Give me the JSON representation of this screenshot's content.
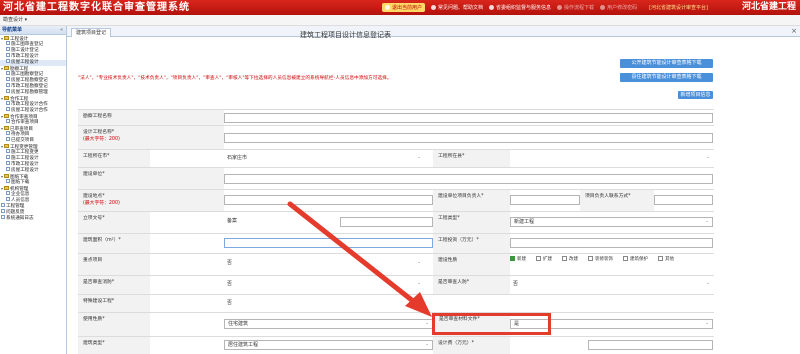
{
  "header": {
    "title_left": "河北省建工程数字化联合审查管理系统",
    "title_right": "河北省建工程",
    "nav": [
      {
        "label": "退出当前用户",
        "active": true
      },
      {
        "label": "常见问题、帮助文档",
        "active": false
      },
      {
        "label": "省委组织监督与服务信息",
        "active": false
      },
      {
        "label": "操作流程下载",
        "active": false,
        "disabled": true
      },
      {
        "label": "用户修改密码",
        "active": false,
        "disabled": true
      }
    ],
    "bracket_title": "[河北省建筑设计审查平台]"
  },
  "user_menu": "勘查设计 ▾",
  "sidebar": {
    "header": "导航菜单",
    "close": "«",
    "items": [
      {
        "label": "工程设计",
        "level": 0,
        "type": "folder",
        "toggle": "▾"
      },
      {
        "label": "施工图审查登记",
        "level": 1,
        "type": "file"
      },
      {
        "label": "施工设计登记",
        "level": 1,
        "type": "file"
      },
      {
        "label": "市政工程设计",
        "level": 1,
        "type": "file"
      },
      {
        "label": "房屋工程设计",
        "level": 1,
        "type": "file",
        "selected": true
      },
      {
        "label": "勘察工程",
        "level": 0,
        "type": "folder",
        "toggle": "▾"
      },
      {
        "label": "施工图勘察登记",
        "level": 1,
        "type": "file"
      },
      {
        "label": "房屋工程勘察登记",
        "level": 1,
        "type": "file"
      },
      {
        "label": "市政工程勘察登记",
        "level": 1,
        "type": "file"
      },
      {
        "label": "房屋工程勘察管理",
        "level": 1,
        "type": "file"
      },
      {
        "label": "合作工程",
        "level": 0,
        "type": "folder",
        "toggle": "▾"
      },
      {
        "label": "市政工程设计合作",
        "level": 1,
        "type": "file"
      },
      {
        "label": "房屋工程设计合作",
        "level": 1,
        "type": "file"
      },
      {
        "label": "合作审查项目",
        "level": 0,
        "type": "folder",
        "toggle": "▾"
      },
      {
        "label": "合作审查项目",
        "level": 1,
        "type": "file"
      },
      {
        "label": "已审查项目",
        "level": 0,
        "type": "folder",
        "toggle": "▾"
      },
      {
        "label": "待办项目",
        "level": 1,
        "type": "file"
      },
      {
        "label": "已提交项目",
        "level": 1,
        "type": "file"
      },
      {
        "label": "工程变更管理",
        "level": 0,
        "type": "folder",
        "toggle": "▾"
      },
      {
        "label": "施工工程变更",
        "level": 1,
        "type": "file"
      },
      {
        "label": "施工工程设计",
        "level": 1,
        "type": "file"
      },
      {
        "label": "市政工程设计",
        "level": 1,
        "type": "file"
      },
      {
        "label": "房屋工程设计",
        "level": 1,
        "type": "file"
      },
      {
        "label": "图纸下载",
        "level": 0,
        "type": "folder",
        "toggle": "▾"
      },
      {
        "label": "图纸下载",
        "level": 1,
        "type": "file"
      },
      {
        "label": "机构管理",
        "level": 0,
        "type": "folder",
        "toggle": "▾"
      },
      {
        "label": "企业信息",
        "level": 1,
        "type": "file"
      },
      {
        "label": "人员信息",
        "level": 1,
        "type": "file"
      },
      {
        "label": "工程管理",
        "level": 0,
        "type": "file"
      },
      {
        "label": "问题反馈",
        "level": 0,
        "type": "file"
      },
      {
        "label": "系统通知日志",
        "level": 0,
        "type": "file"
      }
    ]
  },
  "tab": {
    "label": "建筑项目登记",
    "close": "×"
  },
  "form": {
    "title": "建筑工程项目设计信息登记表",
    "btn_public": "公开建筑节能设计审查表格下载",
    "btn_county": "县住建筑节能设计审查表格下载",
    "btn_extra": "新增项目信息",
    "note": "\"法人\"，\"专业技术负责人\"，\"技术负责人\"，\"项目负责人\"，\"审查人\"，\"审核人\"等下拉选择的人员信息被建立的系统导航栏-人员信息中添加方可选择。",
    "labels": {
      "survey_name": "勘察工程名称",
      "design_name": "设计工程名称*",
      "design_name_hint": "(最大字符：200)",
      "city": "工程所在市*",
      "county": "工程所在县*",
      "unit": "建设单位*",
      "address": "建设地点*",
      "address_hint": "(最大字符：200)",
      "builder_person": "建设单位项目负责人*",
      "person_contact": "项目负责人联系方式*",
      "approval_no": "立项文号*",
      "project_type": "工程类型*",
      "area": "建筑面积（m²）*",
      "investment": "工程投资（万元）*",
      "key_project": "重点项目",
      "construction_nature": "建设性质",
      "review_req": "是否审查消防*",
      "review_person": "是否审查人防*",
      "special": "特殊建设工程*",
      "use_nature": "使用性质*",
      "material_doc": "是否审查材料文件*",
      "building_type": "建筑类型*",
      "design_fee": "设计费（万元）*"
    },
    "values": {
      "city": "石家庄市",
      "approval_no": "备案",
      "project_type": "新建工程",
      "key_project": "否",
      "review_req": "否",
      "review_person": "否",
      "special": "否",
      "use_nature": "住宅建筑",
      "material_doc": "是",
      "building_type": "居住建筑工程"
    },
    "checkbox_options": [
      {
        "label": "新建",
        "checked": true
      },
      {
        "label": "扩建",
        "checked": false
      },
      {
        "label": "改建",
        "checked": false
      },
      {
        "label": "装修装饰",
        "checked": false
      },
      {
        "label": "建筑保护",
        "checked": false
      },
      {
        "label": "其他",
        "checked": false
      }
    ]
  },
  "colors": {
    "banner": "#c81a12",
    "highlight": "#e53b2c",
    "button": "#4a8fd9"
  }
}
